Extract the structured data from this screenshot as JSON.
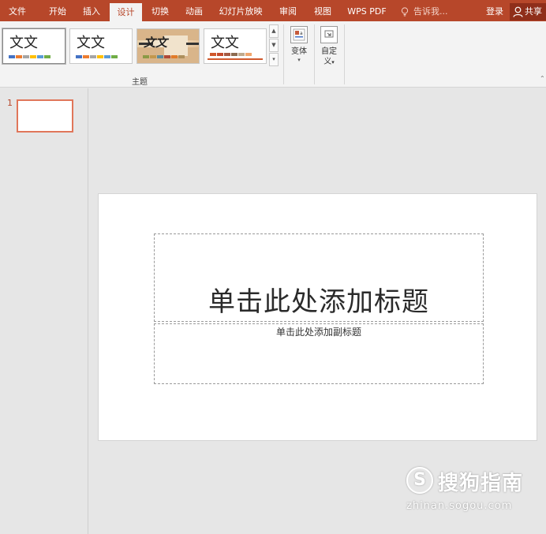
{
  "tabs": [
    {
      "label": "文件"
    },
    {
      "label": "开始"
    },
    {
      "label": "插入"
    },
    {
      "label": "设计"
    },
    {
      "label": "切换"
    },
    {
      "label": "动画"
    },
    {
      "label": "幻灯片放映"
    },
    {
      "label": "审阅"
    },
    {
      "label": "视图"
    },
    {
      "label": "WPS PDF"
    }
  ],
  "active_tab": "设计",
  "tell_me": "告诉我...",
  "login": "登录",
  "share": "共享",
  "ribbon": {
    "themes": [
      {
        "label": "文文",
        "colors": [
          "#4472c4",
          "#ed7d31",
          "#a5a5a5",
          "#ffc000",
          "#5b9bd5",
          "#70ad47"
        ]
      },
      {
        "label": "文文",
        "colors": [
          "#4472c4",
          "#ed7d31",
          "#a5a5a5",
          "#ffc000",
          "#5b9bd5",
          "#70ad47"
        ]
      },
      {
        "label": "文文",
        "colors": [
          "#8b9a46",
          "#c3984d",
          "#5c8a9c",
          "#b04a38",
          "#e17b29",
          "#ad8f5c"
        ]
      },
      {
        "label": "文文",
        "colors": [
          "#d0582b",
          "#c44b2c",
          "#a55a43",
          "#8c6b4f",
          "#bfa98d",
          "#f0a66e"
        ]
      }
    ],
    "group_label": "主题",
    "variant_label": "变体",
    "customize_label_1": "自定",
    "customize_label_2": "义"
  },
  "thumbnail_number": "1",
  "slide": {
    "title_placeholder": "单击此处添加标题",
    "subtitle_placeholder": "单击此处添加副标题"
  },
  "watermark": {
    "logo": "S",
    "text": "搜狗指南",
    "url": "zhinan.sogou.com"
  }
}
